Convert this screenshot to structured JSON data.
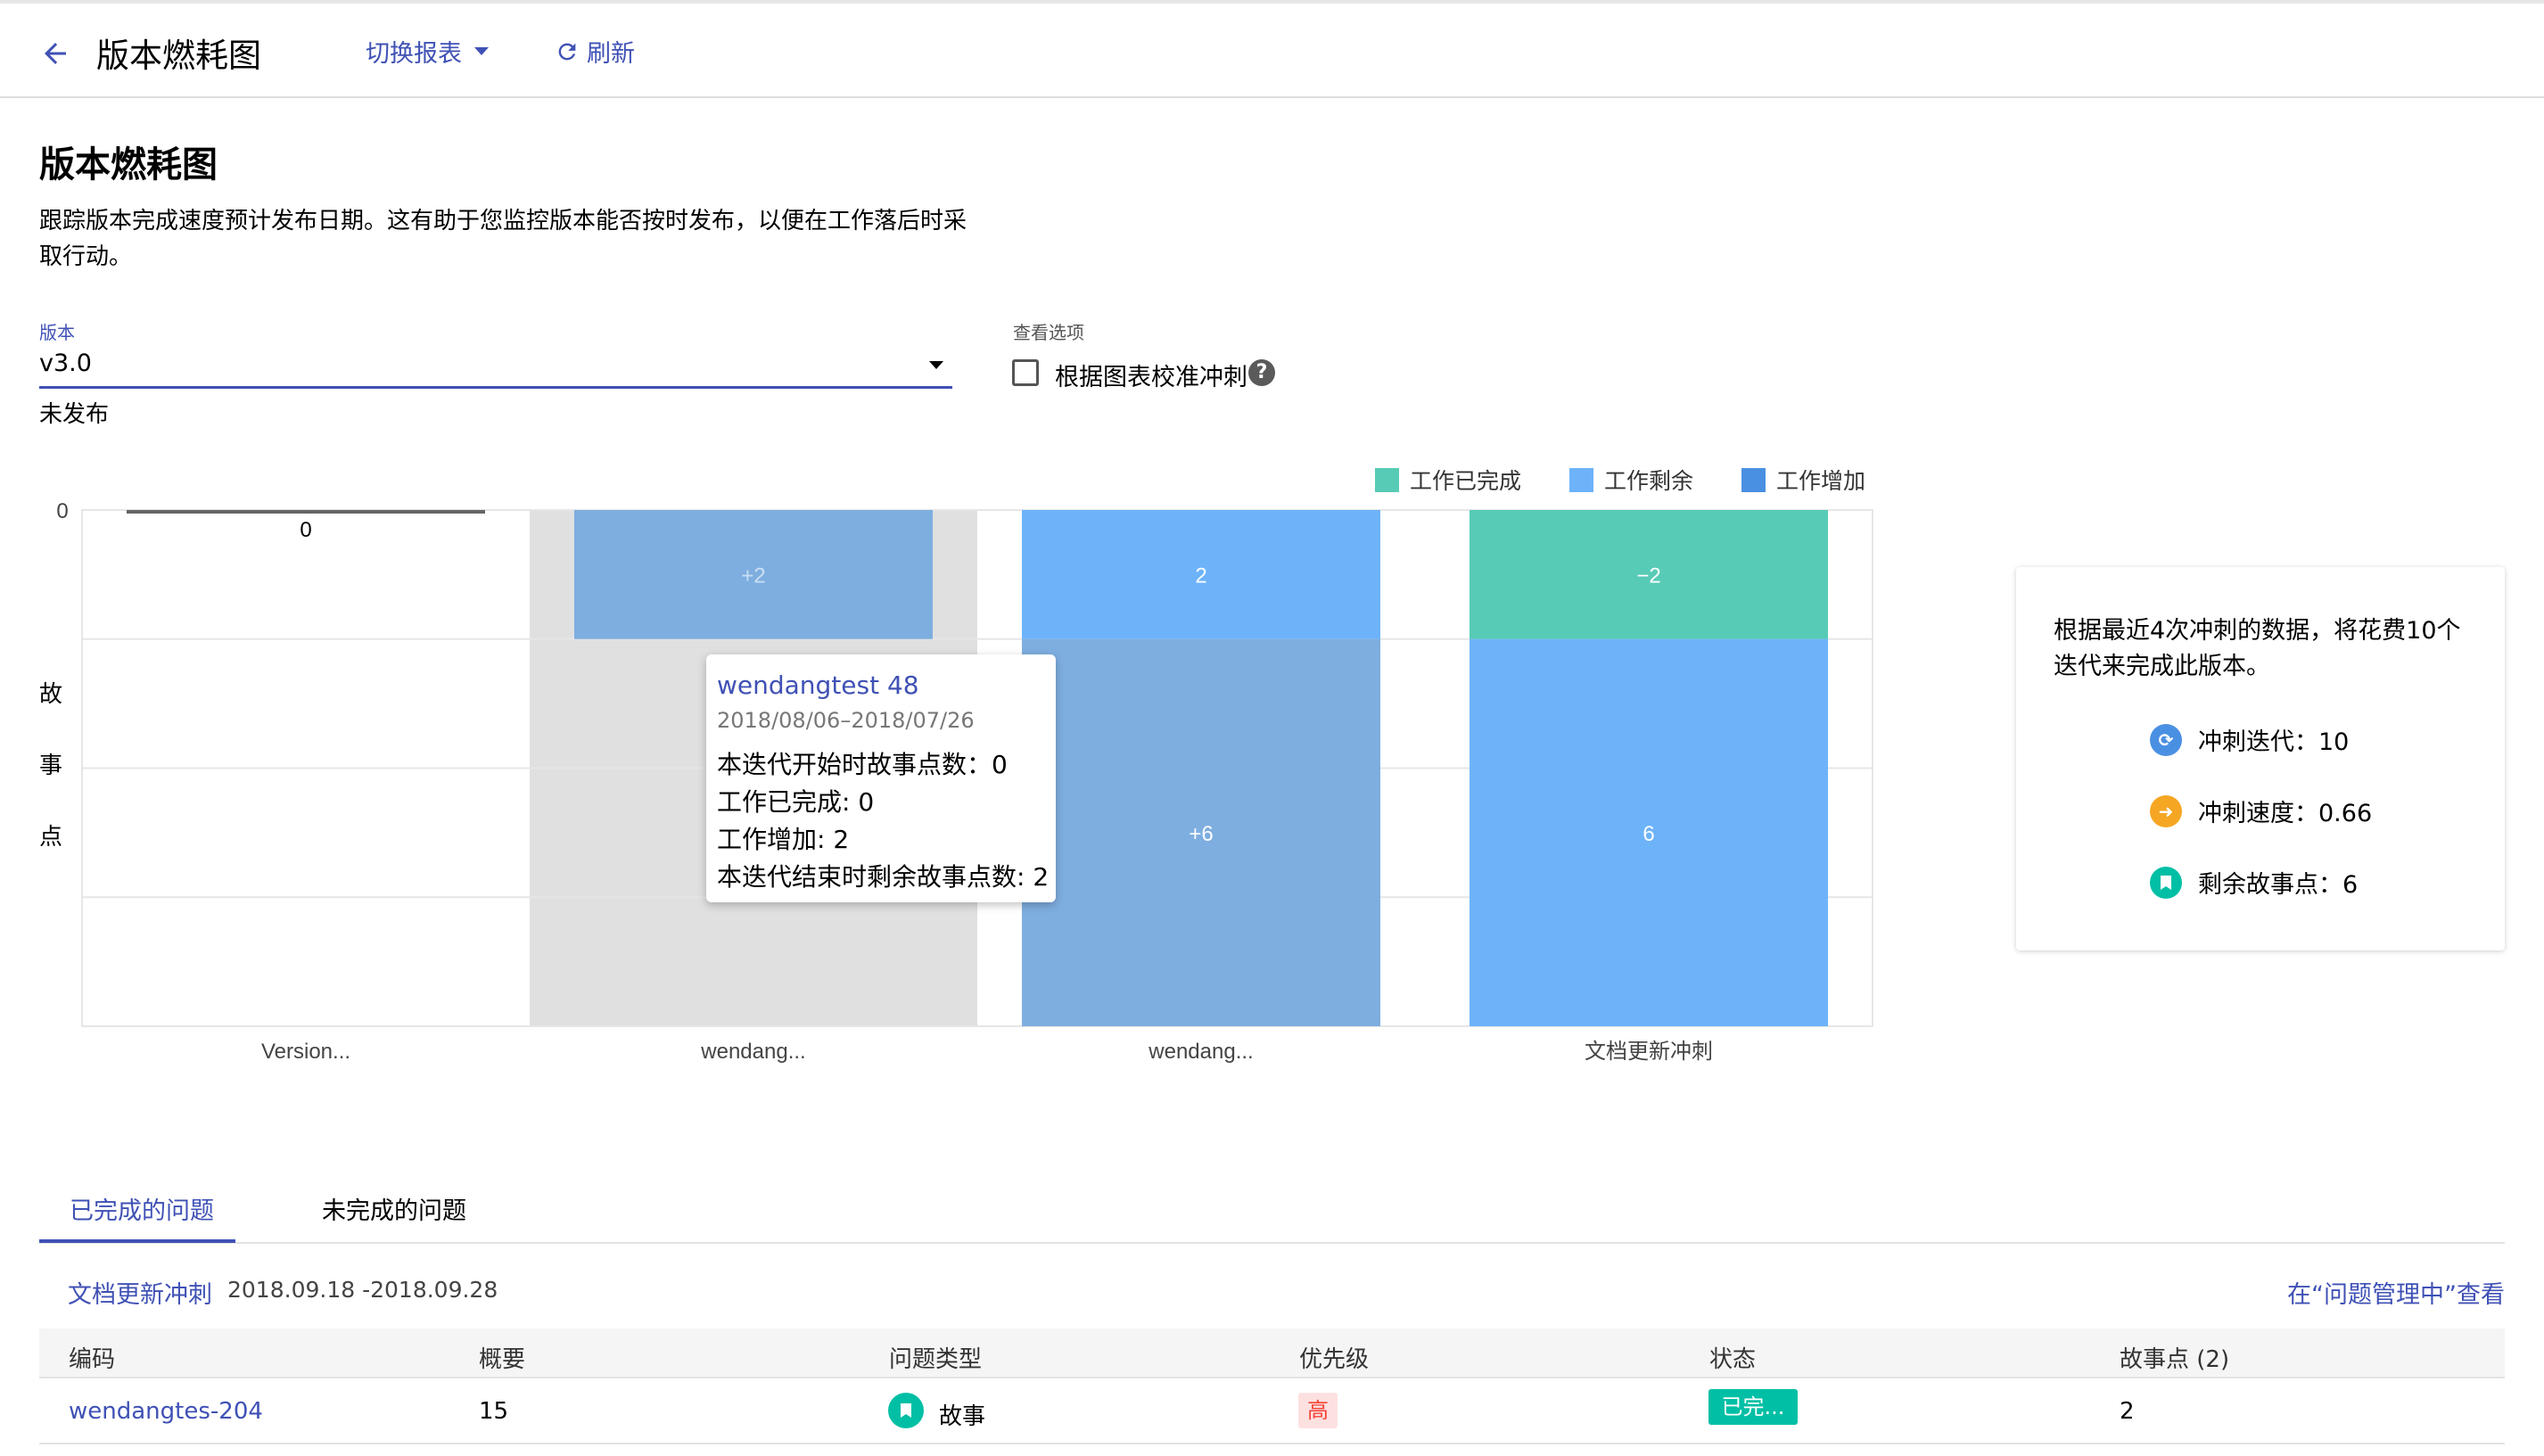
{
  "header": {
    "title": "版本燃耗图",
    "switch_report": "切换报表",
    "refresh": "刷新"
  },
  "page": {
    "title": "版本燃耗图",
    "description": "跟踪版本完成速度预计发布日期。这有助于您监控版本能否按时发布，以便在工作落后时采取行动。"
  },
  "version": {
    "label": "版本",
    "value": "v3.0",
    "status": "未发布"
  },
  "view_options": {
    "label": "查看选项",
    "checkbox_label": "根据图表校准冲刺",
    "checked": false
  },
  "colors": {
    "done": "#57cbb6",
    "remaining": "#6db3fa",
    "added": "#7eaee0",
    "accent": "#3f51b5"
  },
  "chart_data": {
    "type": "bar",
    "legend": [
      {
        "label": "工作已完成",
        "color": "#57cbb6"
      },
      {
        "label": "工作剩余",
        "color": "#6db3fa"
      },
      {
        "label": "工作增加",
        "color": "#4a90e2"
      }
    ],
    "ylabel": "故事点",
    "y_tick": "0",
    "categories": [
      "Version...",
      "wendang...",
      "wendang...",
      "文档更新冲刺"
    ],
    "bars": [
      {
        "category": "Version...",
        "total_label": "0",
        "segments": []
      },
      {
        "category": "wendang...",
        "segments": [
          {
            "kind": "added",
            "value": 2,
            "label": "+2"
          }
        ]
      },
      {
        "category": "wendang...",
        "segments": [
          {
            "kind": "remaining",
            "value": 2,
            "label": "2"
          },
          {
            "kind": "added",
            "value": 6,
            "label": "+6"
          }
        ]
      },
      {
        "category": "文档更新冲刺",
        "segments": [
          {
            "kind": "done",
            "value": -2,
            "label": "−2"
          },
          {
            "kind": "remaining",
            "value": 6,
            "label": "6"
          }
        ]
      }
    ]
  },
  "tooltip": {
    "title": "wendangtest 48",
    "date": "2018/08/06–2018/07/26",
    "start_points": "本迭代开始时故事点数：0",
    "done": "工作已完成: 0",
    "added": "工作增加: 2",
    "end_remaining": "本迭代结束时剩余故事点数: 2"
  },
  "summary": {
    "text": "根据最近4次冲刺的数据，将花费10个迭代来完成此版本。",
    "iterations": "冲刺迭代：10",
    "velocity": "冲刺速度：0.66",
    "remaining": "剩余故事点：6"
  },
  "tabs": {
    "completed": "已完成的问题",
    "incomplete": "未完成的问题"
  },
  "sprint": {
    "name": "文档更新冲刺",
    "dates": "2018.09.18 -2018.09.28",
    "view_in": "在“问题管理中”查看"
  },
  "table": {
    "headers": {
      "code": "编码",
      "summary": "概要",
      "type": "问题类型",
      "priority": "优先级",
      "status": "状态",
      "points": "故事点 (2)"
    },
    "rows": [
      {
        "code": "wendangtes-204",
        "summary": "15",
        "type": "故事",
        "priority": "高",
        "status": "已完...",
        "points": "2"
      }
    ]
  }
}
